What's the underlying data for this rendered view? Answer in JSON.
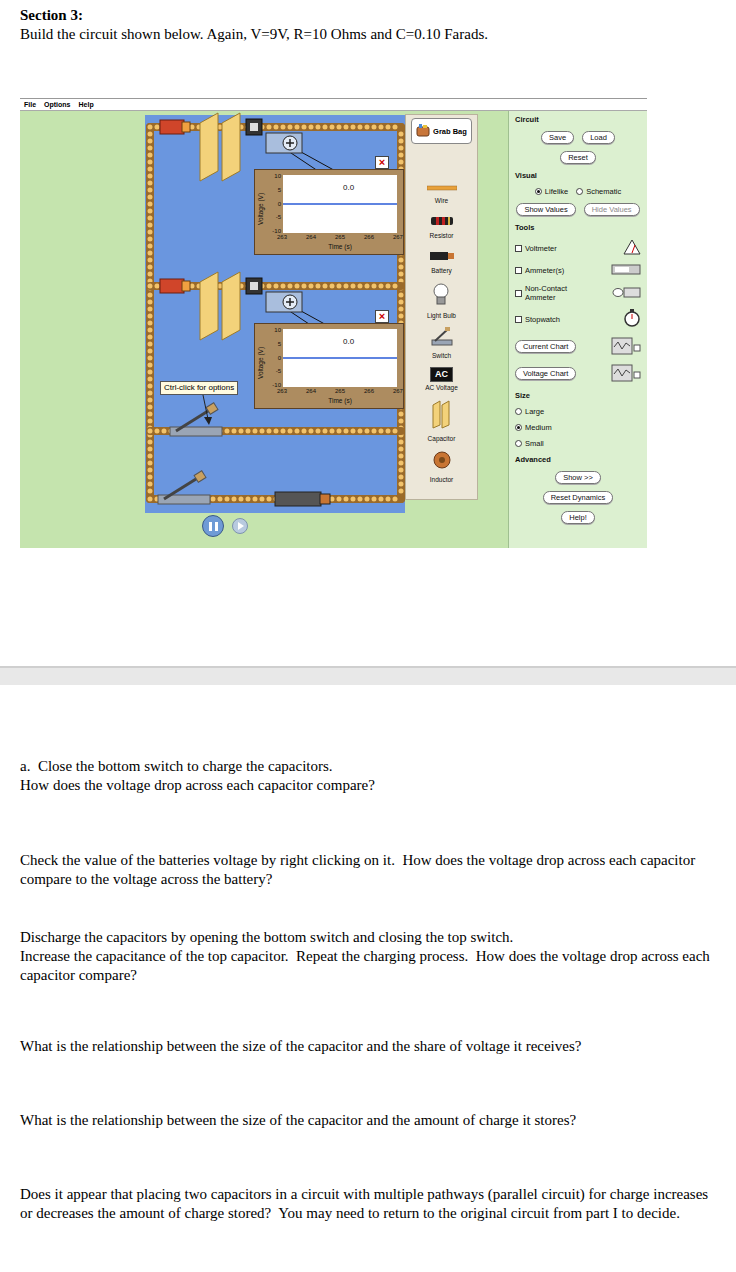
{
  "worksheet": {
    "heading": "Section 3:",
    "intro": "Build the circuit shown below. Again, V=9V, R=10 Ohms and C=0.10 Farads."
  },
  "sim": {
    "menu": [
      "File",
      "Options",
      "Help"
    ],
    "grab_bag": "Grab Bag",
    "palette": [
      {
        "label": "Wire",
        "kind": "wire"
      },
      {
        "label": "Resistor",
        "kind": "resistor"
      },
      {
        "label": "Battery",
        "kind": "battery"
      },
      {
        "label": "Light Bulb",
        "kind": "bulb"
      },
      {
        "label": "Switch",
        "kind": "switch"
      },
      {
        "label": "AC Voltage",
        "kind": "ac",
        "badge": "AC"
      },
      {
        "label": "Capacitor",
        "kind": "capacitor"
      },
      {
        "label": "Inductor",
        "kind": "inductor"
      }
    ],
    "charts": [
      {
        "y_label": "Voltage (V)",
        "y_ticks": [
          "10",
          "5",
          "0",
          "-5",
          "-10"
        ],
        "x_ticks": [
          "263",
          "264",
          "265",
          "266",
          "267"
        ],
        "x_label": "Time (s)",
        "reading": "0.0",
        "close": "×",
        "series": [
          0,
          0,
          0,
          0,
          0
        ]
      },
      {
        "y_label": "Voltage (V)",
        "y_ticks": [
          "10",
          "5",
          "0",
          "-5",
          "-10"
        ],
        "x_ticks": [
          "263",
          "264",
          "265",
          "266",
          "267"
        ],
        "x_label": "Time (s)",
        "reading": "0.0",
        "close": "×",
        "series": [
          0,
          0,
          0,
          0,
          0
        ]
      }
    ],
    "switches": [
      {
        "closed": false
      },
      {
        "closed": false
      }
    ],
    "tooltip": "Ctrl-click for options",
    "panel": {
      "circuit_heading": "Circuit",
      "save": "Save",
      "load": "Load",
      "reset": "Reset",
      "visual_heading": "Visual",
      "visual": [
        {
          "label": "Lifelike",
          "selected": true
        },
        {
          "label": "Schematic",
          "selected": false
        }
      ],
      "values_buttons": [
        {
          "label": "Show Values",
          "disabled": false
        },
        {
          "label": "Hide Values",
          "disabled": true
        }
      ],
      "tools_heading": "Tools",
      "tools": [
        {
          "label": "Voltmeter",
          "checked": false
        },
        {
          "label": "Ammeter(s)",
          "checked": false
        },
        {
          "label": "Non-Contact Ammeter",
          "checked": false
        },
        {
          "label": "Stopwatch",
          "checked": false
        }
      ],
      "current_chart": "Current Chart",
      "voltage_chart": "Voltage Chart",
      "size_heading": "Size",
      "sizes": [
        {
          "label": "Large",
          "selected": false
        },
        {
          "label": "Medium",
          "selected": true
        },
        {
          "label": "Small",
          "selected": false
        }
      ],
      "advanced_heading": "Advanced",
      "show_advanced": "Show >>",
      "reset_dynamics": "Reset Dynamics",
      "help": "Help!"
    }
  },
  "questions": [
    {
      "lines": [
        "a.  Close the bottom switch to charge the capacitors.",
        "How does the voltage drop across each capacitor compare?"
      ]
    },
    {
      "lines": [
        "Check the value of the batteries voltage by right clicking on it.  How does the voltage drop across each capacitor compare to the voltage across the battery?"
      ]
    },
    {
      "lines": [
        "Discharge the capacitors by opening the bottom switch and closing the top switch.",
        "Increase the capacitance of the top capacitor.  Repeat the charging process.  How does the voltage drop across each capacitor compare?"
      ]
    },
    {
      "lines": [
        "What is the relationship between the size of the capacitor and the share of voltage it receives?"
      ]
    },
    {
      "lines": [
        "What is the relationship between the size of the capacitor and the amount of charge it stores?"
      ]
    },
    {
      "lines": [
        "Does it appear that placing two capacitors in a circuit with multiple pathways (parallel circuit) for charge increases or decreases the amount of charge stored?  You may need to return to the original circuit from part I to decide."
      ]
    }
  ]
}
